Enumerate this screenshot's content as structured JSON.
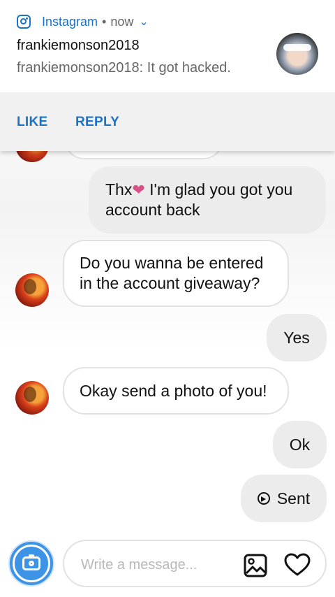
{
  "notification": {
    "app_name": "Instagram",
    "separator": "•",
    "time": "now",
    "title": "frankiemonson2018",
    "text": "frankiemonson2018: It got hacked.",
    "actions": {
      "like": "LIKE",
      "reply": "REPLY"
    }
  },
  "messages": [
    {
      "from": "me",
      "text_before": "Thx",
      "emoji": "heart",
      "text_after": " I'm glad you got you account back"
    },
    {
      "from": "them",
      "text": "Do you wanna be entered in the account giveaway?"
    },
    {
      "from": "me",
      "text": "Yes"
    },
    {
      "from": "them",
      "text": "Okay send a photo of you!"
    },
    {
      "from": "me",
      "text": "Ok"
    },
    {
      "from": "me",
      "text": "Sent",
      "icon": "sent-icon"
    }
  ],
  "composer": {
    "placeholder": "Write a message..."
  },
  "colors": {
    "accent": "#1a73c8",
    "camera": "#3d94e6",
    "heart": "#d94f86"
  }
}
